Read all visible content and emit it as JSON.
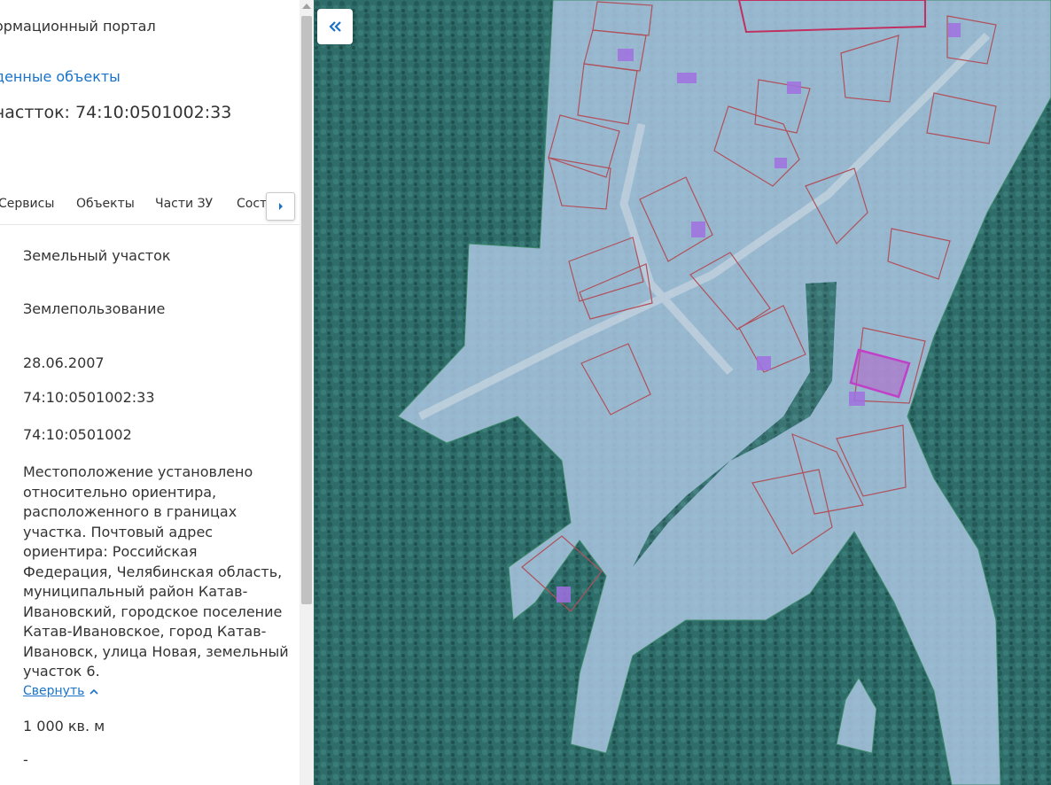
{
  "panel": {
    "portal_title": "ормационный портал",
    "found_objects_link": "денные объекты",
    "parcel_title": "частток: 74:10:0501002:33"
  },
  "tabs": [
    {
      "label": "Сервисы"
    },
    {
      "label": "Объекты"
    },
    {
      "label": "Части ЗУ"
    },
    {
      "label": "Соста"
    }
  ],
  "fields": {
    "object_type": "Земельный участок",
    "category": "Землепользование",
    "date": "28.06.2007",
    "cad_number": "74:10:0501002:33",
    "cad_quarter": "74:10:0501002",
    "address": "Местоположение установлено относительно ориентира, расположенного в границах участка. Почтовый адрес ориентира: Российская Федерация, Челябинская область, муниципальный район Катав-Ивановский, городское поселение Катав-Ивановское, город Катав-Ивановск, улица Новая, земельный участок 6.",
    "collapse_label": "Свернуть",
    "area": "1 000 кв. м",
    "dash": "-"
  },
  "icons": {
    "collapse_panel": "double-chevron-left-icon",
    "tabs_next": "caret-right-icon",
    "collapse_text": "chevron-up-icon"
  },
  "colors": {
    "link": "#1a73c8",
    "forest": "#2d6a68",
    "settlement_overlay": "#aac6e0",
    "parcel_border": "#b0505a",
    "selected_parcel": "#c040c8",
    "building": "#a070e0"
  }
}
